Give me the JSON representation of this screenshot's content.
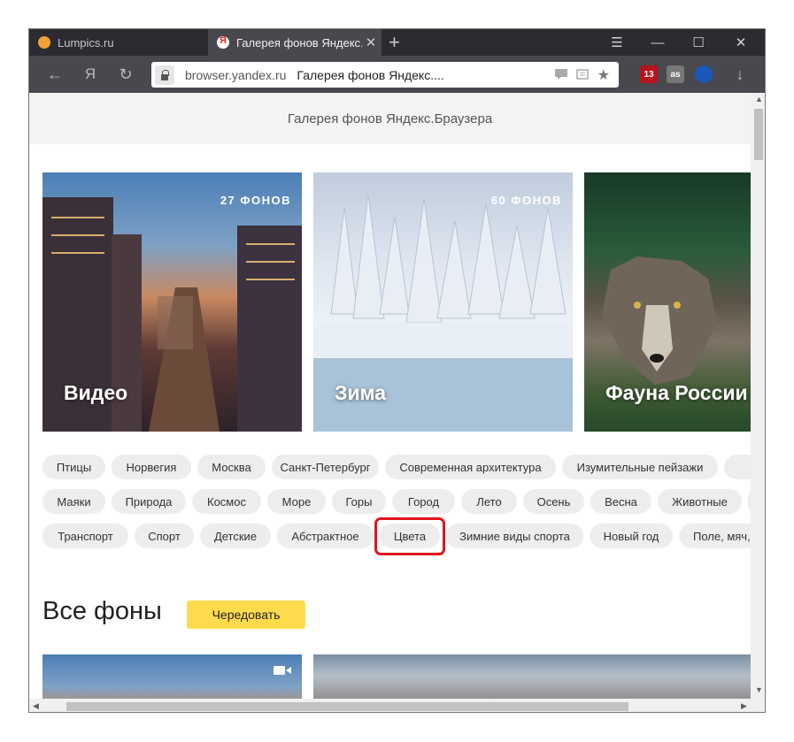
{
  "tabs": [
    {
      "title": "Lumpics.ru",
      "favicon": "orange-circle-icon",
      "active": false
    },
    {
      "title": "Галерея фонов Яндекс.Браузера",
      "favicon": "yandex-icon",
      "active": true,
      "close": "✕"
    }
  ],
  "tabbar": {
    "new_tab": "+",
    "menu": "☰",
    "minimize": "—",
    "maximize": "☐",
    "close": "✕"
  },
  "addressbar": {
    "back": "←",
    "yandex": "Я",
    "reload": "↻",
    "domain": "browser.yandex.ru",
    "page_title": "Галерея фонов Яндекс....",
    "bookmark": "★",
    "download": "↓",
    "ext_badge": "13",
    "ext_lastfm": "as"
  },
  "header": {
    "title": "Галерея фонов Яндекс.Браузера"
  },
  "cards": [
    {
      "name": "Видео",
      "count": "27 ФОНОВ"
    },
    {
      "name": "Зима",
      "count": "60 ФОНОВ"
    },
    {
      "name": "Фауна России",
      "count": ""
    }
  ],
  "chips": {
    "row1": [
      "Птицы",
      "Норвегия",
      "Москва",
      "Санкт-Петербург",
      "Современная архитектура",
      "Изумительные пейзажи"
    ],
    "row2": [
      "Маяки",
      "Природа",
      "Космос",
      "Море",
      "Горы",
      "Город",
      "Лето",
      "Осень",
      "Весна",
      "Животные"
    ],
    "row3": [
      "Транспорт",
      "Спорт",
      "Детские",
      "Абстрактное",
      "Цвета",
      "Зимние виды спорта",
      "Новый год",
      "Поле, мяч,"
    ]
  },
  "highlighted_chip": "Цвета",
  "all_backgrounds": {
    "title": "Все фоны",
    "shuffle_label": "Чередовать"
  },
  "colors": {
    "highlight": "#e1151c",
    "shuffle_button": "#ffdb4d"
  }
}
